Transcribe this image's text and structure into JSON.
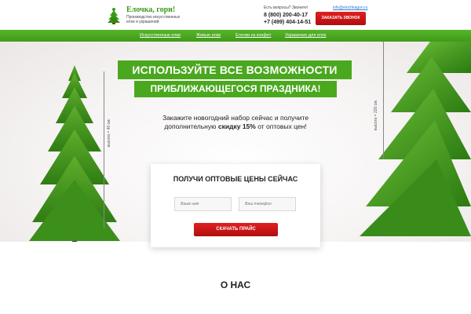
{
  "header": {
    "logo_icon": "christmas-tree-icon",
    "title": "Елочка, гори!",
    "subtitle": "Производство искусственных елок и украшений",
    "question": "Есть вопросы? Звоните!",
    "email": "info@elochkagori.ru",
    "phone1": "8 (800) 200-40-17",
    "phone2": "+7 (499) 404-14-51",
    "call_button": "ЗАКАЗАТЬ ЗВОНОК"
  },
  "nav": {
    "items": [
      {
        "label": "Искусственные елки"
      },
      {
        "label": "Живые елки"
      },
      {
        "label": "Елочки из конфет"
      },
      {
        "label": "Украшение для елок"
      }
    ]
  },
  "hero": {
    "headline1": "ИСПОЛЬЗУЙТЕ ВСЕ ВОЗМОЖНОСТИ",
    "headline2": "ПРИБЛИЖАЮЩЕГОСЯ ПРАЗДНИКА!",
    "offer_line1": "Закажите новогодний набор сейчас и получите",
    "offer_line2_prefix": "дополнительную",
    "offer_line2_bold": "скидку 15%",
    "offer_line2_suffix": "от оптовых цен!",
    "measure_left": "высота = 40 см.",
    "measure_right": "высота = 220 см."
  },
  "form": {
    "title": "ПОЛУЧИ ОПТОВЫЕ ЦЕНЫ СЕЙЧАС",
    "name_placeholder": "Ваше имя",
    "phone_placeholder": "Ваш телефон",
    "submit": "СКАЧАТЬ ПРАЙС"
  },
  "about": {
    "title": "О НАС"
  },
  "colors": {
    "brand_green": "#4aa81e",
    "accent_red": "#d01818"
  }
}
